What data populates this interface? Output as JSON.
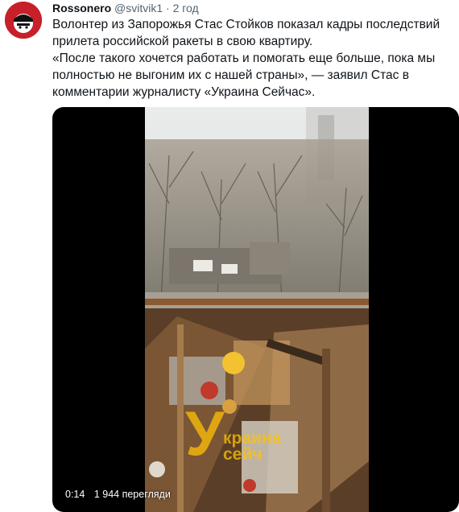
{
  "tweet": {
    "author": "Rossonero",
    "handle": "@svitvik1",
    "time": "· 2 год",
    "text_lines": [
      "Волонтер из Запорожья Стас Стойков показал кадры последствий прилета российской ракеты в свою квартиру.",
      "«После такого хочется работать и помогать еще больше, пока мы полностью не выгоним их с нашей страны», — заявил Стас в комментарии журналисту «Украина Сейчас»."
    ]
  },
  "video": {
    "duration": "0:14",
    "views": "1 944 перегляди",
    "watermark_letter": "У",
    "watermark_line1": "крaина",
    "watermark_line2": "сейч"
  },
  "colors": {
    "avatar_red": "#c8202a",
    "watermark_yellow": "#ffc107",
    "handle_grey": "#536471"
  }
}
